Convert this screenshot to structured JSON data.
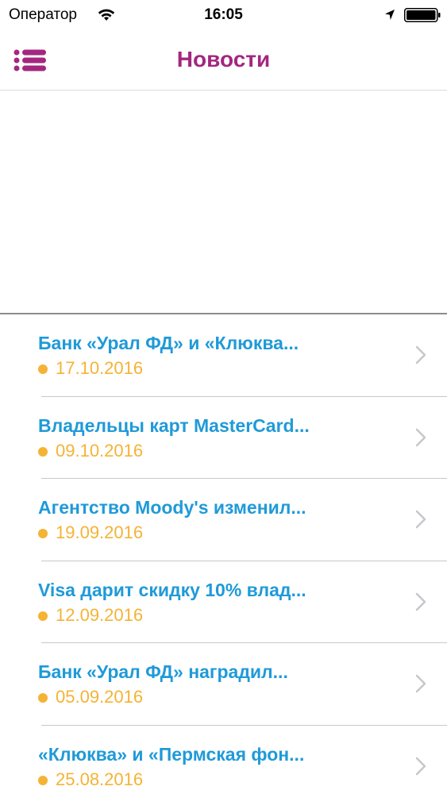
{
  "status_bar": {
    "carrier": "Оператор",
    "time": "16:05"
  },
  "nav": {
    "title": "Новости",
    "menu_icon": "list-menu-icon"
  },
  "colors": {
    "accent": "#a3277f",
    "title_blue": "#1f9ad8",
    "date_orange": "#f5b335"
  },
  "news": [
    {
      "title": "Банк «Урал ФД» и «Клюква...",
      "date": "17.10.2016"
    },
    {
      "title": "Владельцы карт MasterCard...",
      "date": "09.10.2016"
    },
    {
      "title": "Агентство Moody's изменил...",
      "date": "19.09.2016"
    },
    {
      "title": " Visa дарит скидку 10% влад...",
      "date": "12.09.2016"
    },
    {
      "title": " Банк «Урал ФД» наградил...",
      "date": "05.09.2016"
    },
    {
      "title": "«Клюква» и «Пермская фон...",
      "date": "25.08.2016"
    }
  ]
}
